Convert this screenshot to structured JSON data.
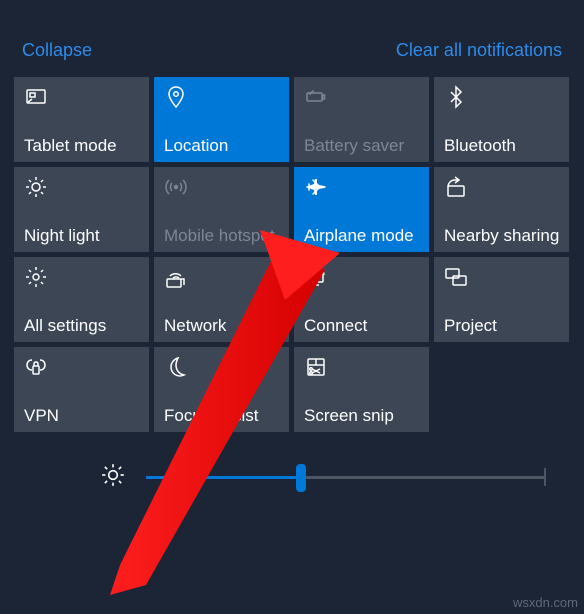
{
  "header": {
    "collapse": "Collapse",
    "clear": "Clear all notifications"
  },
  "tiles": [
    {
      "name": "tablet-mode",
      "label": "Tablet mode",
      "icon": "tablet",
      "state": "normal"
    },
    {
      "name": "location",
      "label": "Location",
      "icon": "location",
      "state": "active"
    },
    {
      "name": "battery-saver",
      "label": "Battery saver",
      "icon": "battery",
      "state": "disabled"
    },
    {
      "name": "bluetooth",
      "label": "Bluetooth",
      "icon": "bluetooth",
      "state": "normal"
    },
    {
      "name": "night-light",
      "label": "Night light",
      "icon": "sun",
      "state": "normal"
    },
    {
      "name": "mobile-hotspot",
      "label": "Mobile hotspot",
      "icon": "hotspot",
      "state": "disabled"
    },
    {
      "name": "airplane-mode",
      "label": "Airplane mode",
      "icon": "airplane",
      "state": "active"
    },
    {
      "name": "nearby-sharing",
      "label": "Nearby sharing",
      "icon": "share",
      "state": "normal"
    },
    {
      "name": "all-settings",
      "label": "All settings",
      "icon": "gear",
      "state": "normal"
    },
    {
      "name": "network",
      "label": "Network",
      "icon": "wifi",
      "state": "normal"
    },
    {
      "name": "connect",
      "label": "Connect",
      "icon": "connect",
      "state": "normal"
    },
    {
      "name": "project",
      "label": "Project",
      "icon": "project",
      "state": "normal"
    },
    {
      "name": "vpn",
      "label": "VPN",
      "icon": "vpn",
      "state": "normal"
    },
    {
      "name": "focus-assist",
      "label": "Focus assist",
      "icon": "moon",
      "state": "normal"
    },
    {
      "name": "screen-snip",
      "label": "Screen snip",
      "icon": "snip",
      "state": "normal"
    }
  ],
  "brightness": {
    "value": 39
  },
  "watermark": "wsxdn.com"
}
